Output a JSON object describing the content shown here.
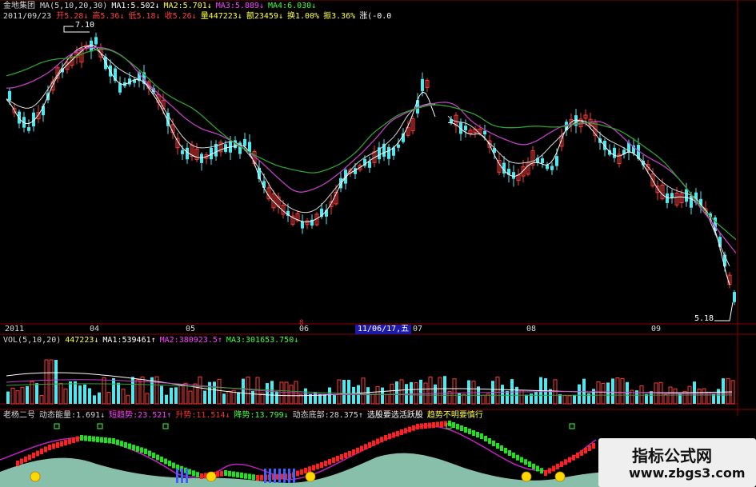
{
  "stock": {
    "name": "金地集团",
    "ma_line": [
      {
        "text": "MA(5,10,20,30)",
        "color": "#d8d8d8"
      },
      {
        "text": "MA1:5.502↓",
        "color": "#ffffff"
      },
      {
        "text": "MA2:5.701↓",
        "color": "#ffff40"
      },
      {
        "text": "MA3:5.889↓",
        "color": "#ff40ff"
      },
      {
        "text": "MA4:6.030↓",
        "color": "#40ff40"
      }
    ],
    "date": "2011/09/23",
    "quote_line": [
      {
        "text": "开5.28↓",
        "color": "#ff4040"
      },
      {
        "text": "高5.36↓",
        "color": "#ff4040"
      },
      {
        "text": "低5.18↓",
        "color": "#ff4040"
      },
      {
        "text": "收5.26↓",
        "color": "#ff4040"
      },
      {
        "text": "量447223↓",
        "color": "#ffff40"
      },
      {
        "text": "额23459↓",
        "color": "#ffff40"
      },
      {
        "text": "换1.00%",
        "color": "#ffff40"
      },
      {
        "text": "振3.36%",
        "color": "#ffff40"
      },
      {
        "text": "涨(-0.0",
        "color": "#ffffff"
      }
    ],
    "high_label": "7.10",
    "low_label": "5.18",
    "marker_label": "8"
  },
  "time_axis": {
    "labels": [
      "2011",
      "04",
      "05",
      "06",
      "07",
      "08",
      "09"
    ],
    "cursor_date": "11/06/17,五"
  },
  "volume": {
    "header": [
      {
        "text": "VOL(5,10,20)",
        "color": "#d8d8d8"
      },
      {
        "text": "447223↓",
        "color": "#ffff40"
      },
      {
        "text": "MA1:539461↑",
        "color": "#ffffff"
      },
      {
        "text": "MA2:380923.5↑",
        "color": "#ff40ff"
      },
      {
        "text": "MA3:301653.750↓",
        "color": "#40ff40"
      }
    ]
  },
  "indicator": {
    "header": [
      {
        "text": "老杨二号",
        "color": "#d8d8d8"
      },
      {
        "text": "动态能量:1.691↓",
        "color": "#d8d8d8"
      },
      {
        "text": "短趋势:23.521↑",
        "color": "#ff40ff"
      },
      {
        "text": "升势:11.514↓",
        "color": "#ff3030"
      },
      {
        "text": "降势:13.799↓",
        "color": "#40ff40"
      },
      {
        "text": "动态底部:28.375↑",
        "color": "#d8d8d8"
      },
      {
        "text": "选股要选活跃股",
        "color": "#ffffff"
      },
      {
        "text": "趋势不明要慎行",
        "color": "#ffff40"
      }
    ]
  },
  "colors": {
    "up": "#ff3a3a",
    "down": "#50e8f0",
    "grid": "#8b0000",
    "ma1": "#ffffff",
    "ma2": "#d8d8d8",
    "ma3": "#c040c0",
    "ma4": "#30a030"
  },
  "watermark": {
    "title": "指标公式网",
    "url": "www.zbgs3.com"
  }
}
